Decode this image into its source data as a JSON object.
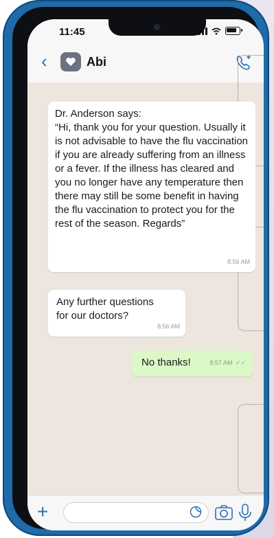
{
  "status_bar": {
    "time": "11:45"
  },
  "header": {
    "contact_name": "Abi"
  },
  "messages": [
    {
      "text": "Dr. Anderson says:\n“Hi, thank you for your question. Usually it is not advisable to have the flu vaccination if you are already suffering from an illness or a fever. If the illness has cleared and you no longer have any temperature then there may still be some benefit in having the flu vaccination to protect you for the rest of the season. Regards”",
      "time": "8:56 AM",
      "direction": "incoming"
    },
    {
      "text": "Any further questions\nfor our doctors?",
      "time": "8:56 AM",
      "direction": "incoming"
    },
    {
      "text": "No thanks!",
      "time": "8:57 AM",
      "direction": "outgoing",
      "read_ticks": "✓✓"
    }
  ],
  "icons": {
    "back": "chevron-left-icon",
    "avatar": "heart-icon",
    "call": "add-call-icon",
    "attach": "plus-icon",
    "sticker": "sticker-icon",
    "camera": "camera-icon",
    "mic": "microphone-icon"
  },
  "colors": {
    "accent": "#2b6fb6",
    "chat_background": "#ece6de",
    "outgoing_bubble": "#dcf8c6",
    "incoming_bubble": "#ffffff",
    "phone_frame": "#1f6aa8"
  }
}
